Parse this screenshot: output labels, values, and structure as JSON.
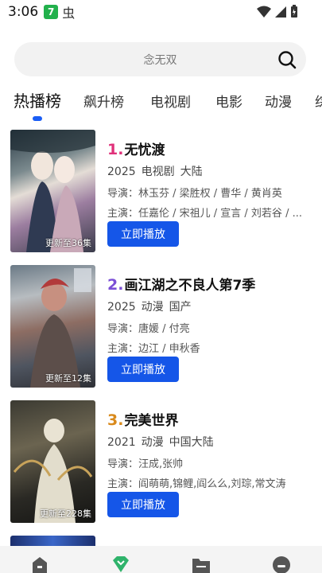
{
  "status": {
    "time": "3:06",
    "app_badge": "7",
    "notify_glyph": "虫"
  },
  "search": {
    "placeholder": "念无双"
  },
  "tabs": [
    {
      "label": "热播榜"
    },
    {
      "label": "飙升榜"
    },
    {
      "label": "电视剧"
    },
    {
      "label": "电影"
    },
    {
      "label": "动漫"
    },
    {
      "label": "综"
    }
  ],
  "items": [
    {
      "rank": "1.",
      "title": "无忧渡",
      "year": "2025",
      "type": "电视剧",
      "region": "大陆",
      "director": "导演：林玉芬 / 梁胜权 / 曹华 / 黄肖英",
      "cast": "主演：任嘉伦 / 宋祖儿 / 宣言 / 刘若谷 / ...",
      "update": "更新至36集",
      "play_label": "立即播放",
      "rank_color": "#e0317a"
    },
    {
      "rank": "2.",
      "title": "画江湖之不良人第7季",
      "year": "2025",
      "type": "动漫",
      "region": "国产",
      "director": "导演：唐媛 / 付亮",
      "cast": "主演：边江 / 申秋香",
      "update": "更新至12集",
      "play_label": "立即播放",
      "rank_color": "#7b4fd6"
    },
    {
      "rank": "3.",
      "title": "完美世界",
      "year": "2021",
      "type": "动漫",
      "region": "中国大陆",
      "director": "导演：汪成,张帅",
      "cast": "主演：阎萌萌,锦鲤,阎么么,刘琮,常文涛",
      "update": "更新至228集",
      "play_label": "立即播放",
      "rank_color": "#d98a1c"
    }
  ],
  "bottom_nav": [
    {
      "icon": "home-icon"
    },
    {
      "icon": "diamond-icon",
      "active_color": "#2fb36b"
    },
    {
      "icon": "folder-icon"
    },
    {
      "icon": "profile-icon"
    }
  ]
}
